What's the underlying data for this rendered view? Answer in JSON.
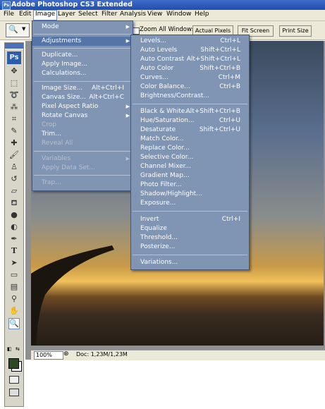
{
  "window": {
    "title": "Adobe Photoshop CS3 Extended"
  },
  "menubar": [
    "File",
    "Edit",
    "Image",
    "Layer",
    "Select",
    "Filter",
    "Analysis",
    "View",
    "Window",
    "Help"
  ],
  "options": {
    "zoom_all_windows": "Zoom All Windows",
    "actual_pixels": "Actual Pixels",
    "fit_screen": "Fit Screen",
    "print_size": "Print Size"
  },
  "toolbox": {
    "logo": "Ps"
  },
  "status": {
    "zoom": "100%",
    "doc": "Doc: 1,23M/1,23M"
  },
  "image_menu": [
    {
      "label": "Mode",
      "shortcut": "",
      "arrow": "▶",
      "disabled": false
    },
    {
      "label": "Adjustments",
      "shortcut": "",
      "arrow": "▶",
      "disabled": false
    },
    {
      "label": "Duplicate...",
      "shortcut": "",
      "arrow": "",
      "disabled": false
    },
    {
      "label": "Apply Image...",
      "shortcut": "",
      "arrow": "",
      "disabled": false
    },
    {
      "label": "Calculations...",
      "shortcut": "",
      "arrow": "",
      "disabled": false
    },
    {
      "label": "Image Size...",
      "shortcut": "Alt+Ctrl+I",
      "arrow": "",
      "disabled": false
    },
    {
      "label": "Canvas Size...",
      "shortcut": "Alt+Ctrl+C",
      "arrow": "",
      "disabled": false
    },
    {
      "label": "Pixel Aspect Ratio",
      "shortcut": "",
      "arrow": "▶",
      "disabled": false
    },
    {
      "label": "Rotate Canvas",
      "shortcut": "",
      "arrow": "▶",
      "disabled": false
    },
    {
      "label": "Crop",
      "shortcut": "",
      "arrow": "",
      "disabled": true
    },
    {
      "label": "Trim...",
      "shortcut": "",
      "arrow": "",
      "disabled": false
    },
    {
      "label": "Reveal All",
      "shortcut": "",
      "arrow": "",
      "disabled": true
    },
    {
      "label": "Variables",
      "shortcut": "",
      "arrow": "▶",
      "disabled": true
    },
    {
      "label": "Apply Data Set...",
      "shortcut": "",
      "arrow": "",
      "disabled": true
    },
    {
      "label": "Trap...",
      "shortcut": "",
      "arrow": "",
      "disabled": true
    }
  ],
  "adjustments_menu": [
    {
      "label": "Levels...",
      "shortcut": "Ctrl+L"
    },
    {
      "label": "Auto Levels",
      "shortcut": "Shift+Ctrl+L"
    },
    {
      "label": "Auto Contrast",
      "shortcut": "Alt+Shift+Ctrl+L"
    },
    {
      "label": "Auto Color",
      "shortcut": "Shift+Ctrl+B"
    },
    {
      "label": "Curves...",
      "shortcut": "Ctrl+M"
    },
    {
      "label": "Color Balance...",
      "shortcut": "Ctrl+B"
    },
    {
      "label": "Brightness/Contrast...",
      "shortcut": ""
    },
    {
      "label": "Black & White...",
      "shortcut": "Alt+Shift+Ctrl+B"
    },
    {
      "label": "Hue/Saturation...",
      "shortcut": "Ctrl+U"
    },
    {
      "label": "Desaturate",
      "shortcut": "Shift+Ctrl+U"
    },
    {
      "label": "Match Color...",
      "shortcut": ""
    },
    {
      "label": "Replace Color...",
      "shortcut": ""
    },
    {
      "label": "Selective Color...",
      "shortcut": ""
    },
    {
      "label": "Channel Mixer...",
      "shortcut": ""
    },
    {
      "label": "Gradient Map...",
      "shortcut": ""
    },
    {
      "label": "Photo Filter...",
      "shortcut": ""
    },
    {
      "label": "Shadow/Highlight...",
      "shortcut": ""
    },
    {
      "label": "Exposure...",
      "shortcut": ""
    },
    {
      "label": "Invert",
      "shortcut": "Ctrl+I"
    },
    {
      "label": "Equalize",
      "shortcut": ""
    },
    {
      "label": "Threshold...",
      "shortcut": ""
    },
    {
      "label": "Posterize...",
      "shortcut": ""
    },
    {
      "label": "Variations...",
      "shortcut": ""
    }
  ]
}
